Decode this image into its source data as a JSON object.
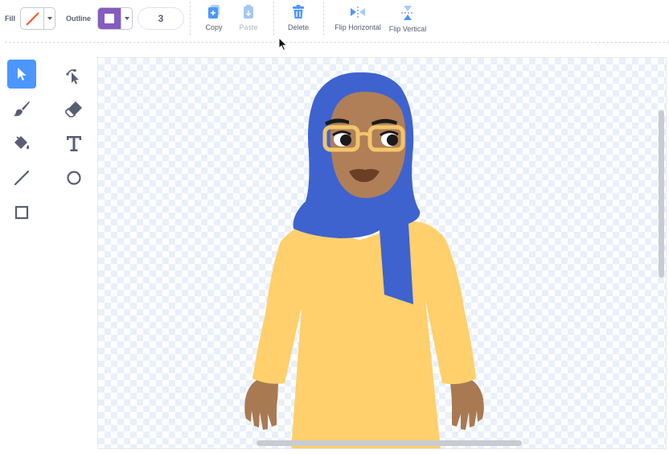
{
  "toolbar": {
    "fill_label": "Fill",
    "outline_label": "Outline",
    "fill_color": "none",
    "outline_color": "#855cbf",
    "outline_width": "3",
    "copy_label": "Copy",
    "paste_label": "Paste",
    "delete_label": "Delete",
    "flip_horizontal_label": "Flip Horizontal",
    "flip_vertical_label": "Flip Vertical"
  },
  "tools": [
    {
      "icon": "select-arrow-icon",
      "active": true
    },
    {
      "icon": "reshape-icon",
      "active": false
    },
    {
      "icon": "brush-icon",
      "active": false
    },
    {
      "icon": "eraser-icon",
      "active": false
    },
    {
      "icon": "fill-bucket-icon",
      "active": false
    },
    {
      "icon": "text-icon",
      "active": false
    },
    {
      "icon": "line-icon",
      "active": false
    },
    {
      "icon": "circle-icon",
      "active": false
    },
    {
      "icon": "rectangle-icon",
      "active": false
    }
  ],
  "colors": {
    "accent": "#4c97ff",
    "text": "#575e75",
    "hijab": "#3e63cf",
    "dress": "#ffd06b",
    "skin": "#b07f57",
    "glasses": "#f2c56b"
  }
}
